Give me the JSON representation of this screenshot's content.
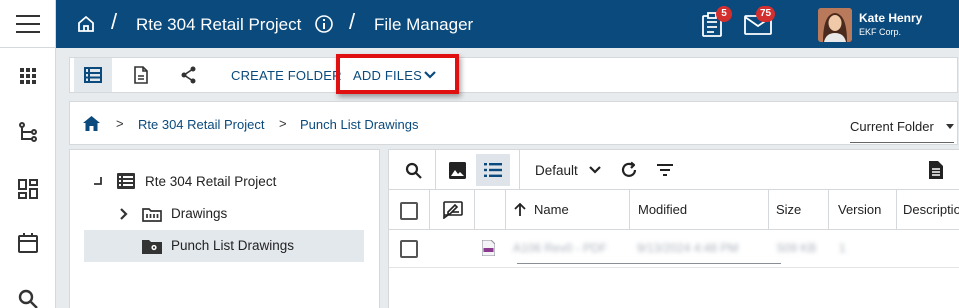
{
  "nav": {
    "project": "Rte 304 Retail Project",
    "page": "File Manager",
    "tasks_badge": "5",
    "mail_badge": "75",
    "user_name": "Kate Henry",
    "user_company": "EKF Corp."
  },
  "toolbar": {
    "create_folder_label": "CREATE FOLDER",
    "add_files_label": "ADD FILES"
  },
  "breadcrumb": {
    "items": [
      "Rte 304 Retail Project",
      "Punch List Drawings"
    ],
    "scope_select": "Current Folder"
  },
  "tree": {
    "root": "Rte 304 Retail Project",
    "children": [
      "Drawings",
      "Punch List Drawings"
    ]
  },
  "files": {
    "view_select": "Default",
    "columns": [
      "Name",
      "Modified",
      "Size",
      "Version",
      "Descriptio"
    ],
    "rows": [
      {
        "name": "A106 Rev0 - PDF",
        "modified": "9/13/2024 4:48 PM",
        "size": "509 KB",
        "version": "1"
      }
    ]
  },
  "colors": {
    "brand": "#0a4a7c",
    "highlight": "#e01010",
    "badge": "#d32f2f"
  }
}
